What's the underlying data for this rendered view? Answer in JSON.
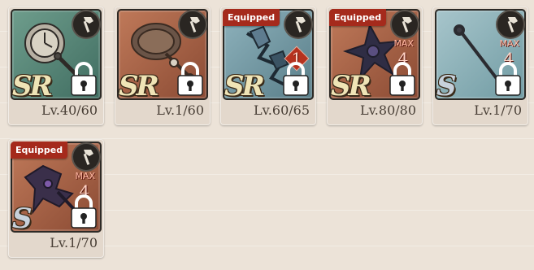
{
  "items": [
    {
      "level": "Lv.40/60",
      "rarity": "SR",
      "equipped": false,
      "max_label": "",
      "stack": "",
      "colors": {
        "bg1": "#6f9e8d",
        "bg2": "#3f6c60"
      },
      "weapon": "clock-mace"
    },
    {
      "level": "Lv.1/60",
      "rarity": "SR",
      "equipped": false,
      "max_label": "",
      "stack": "",
      "colors": {
        "bg1": "#c07a5a",
        "bg2": "#8a4a33"
      },
      "weapon": "disc-axe"
    },
    {
      "level": "Lv.60/65",
      "rarity": "SR",
      "equipped": true,
      "max_label": "",
      "stack": "1",
      "colors": {
        "bg1": "#8fb3bd",
        "bg2": "#587d88"
      },
      "weapon": "crystal-weapon"
    },
    {
      "level": "Lv.80/80",
      "rarity": "SR",
      "equipped": true,
      "max_label": "MAX",
      "stack": "4",
      "colors": {
        "bg1": "#c07a5a",
        "bg2": "#8a4a33"
      },
      "weapon": "spiked-axe"
    },
    {
      "level": "Lv.1/70",
      "rarity": "S",
      "equipped": false,
      "max_label": "MAX",
      "stack": "4",
      "colors": {
        "bg1": "#a8c6cc",
        "bg2": "#6f9aa2"
      },
      "weapon": "rod"
    },
    {
      "level": "Lv.1/70",
      "rarity": "S",
      "equipped": true,
      "max_label": "MAX",
      "stack": "4",
      "colors": {
        "bg1": "#c07a5a",
        "bg2": "#8a4a33"
      },
      "weapon": "dark-axe"
    }
  ],
  "equipped_label": "Equipped"
}
